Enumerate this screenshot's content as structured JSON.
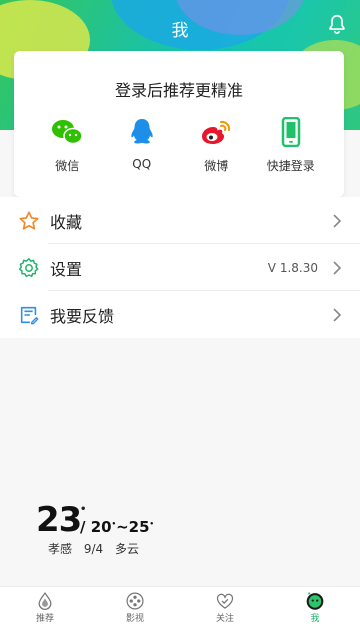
{
  "header": {
    "title": "我"
  },
  "login": {
    "title": "登录后推荐更精准",
    "options": [
      {
        "label": "微信",
        "icon": "wechat-icon"
      },
      {
        "label": "QQ",
        "icon": "qq-icon"
      },
      {
        "label": "微博",
        "icon": "weibo-icon"
      },
      {
        "label": "快捷登录",
        "icon": "phone-icon"
      }
    ]
  },
  "menu": [
    {
      "label": "收藏",
      "value": "",
      "icon": "star-icon"
    },
    {
      "label": "设置",
      "value": "V 1.8.30",
      "icon": "gear-icon"
    },
    {
      "label": "我要反馈",
      "value": "",
      "icon": "feedback-icon"
    }
  ],
  "weather": {
    "temp": "23",
    "low": "20",
    "high": "25",
    "separator": "/",
    "tilde": "~",
    "city": "孝感",
    "date": "9/4",
    "condition": "多云"
  },
  "tabs": [
    {
      "label": "推荐",
      "icon": "drop-icon",
      "active": false
    },
    {
      "label": "影视",
      "icon": "film-reel-icon",
      "active": false
    },
    {
      "label": "关注",
      "icon": "heart-icon",
      "active": false
    },
    {
      "label": "我",
      "icon": "face-icon",
      "active": true
    }
  ],
  "colors": {
    "accent": "#1fc29a",
    "active_tab": "#1fb36a",
    "wechat": "#2dc100",
    "qq": "#1e8fe8",
    "weibo": "#e6162d",
    "phone": "#1fc26a"
  }
}
